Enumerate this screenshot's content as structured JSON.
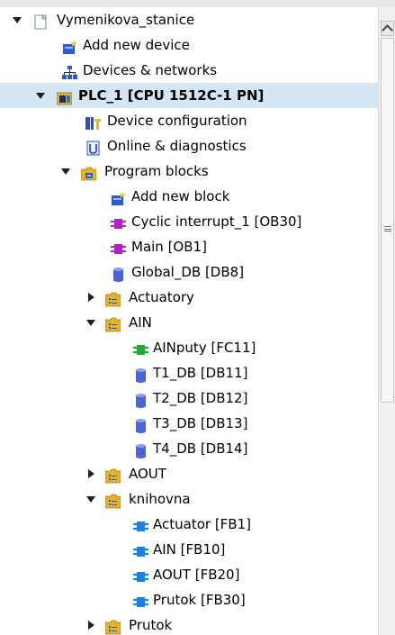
{
  "tree": {
    "items": [
      {
        "label": "Vymenikova_stanice",
        "icon": "project-icon",
        "expander": "down"
      },
      {
        "label": "Add new device",
        "icon": "add-device-icon"
      },
      {
        "label": "Devices & networks",
        "icon": "network-icon"
      },
      {
        "label": "PLC_1 [CPU 1512C-1 PN]",
        "icon": "plc-icon",
        "expander": "down",
        "bold": true,
        "selected": true
      },
      {
        "label": "Device configuration",
        "icon": "device-config-icon"
      },
      {
        "label": "Online & diagnostics",
        "icon": "diagnostics-icon"
      },
      {
        "label": "Program blocks",
        "icon": "folder-icon",
        "expander": "down"
      },
      {
        "label": "Add new block",
        "icon": "add-block-icon"
      },
      {
        "label": "Cyclic interrupt_1 [OB30]",
        "icon": "ob-block-icon"
      },
      {
        "label": "Main [OB1]",
        "icon": "ob-block-icon"
      },
      {
        "label": "Global_DB [DB8]",
        "icon": "db-icon"
      },
      {
        "label": "Actuatory",
        "icon": "group-folder-icon",
        "expander": "right"
      },
      {
        "label": "AIN",
        "icon": "group-folder-icon",
        "expander": "down"
      },
      {
        "label": "AINputy [FC11]",
        "icon": "fc-block-icon"
      },
      {
        "label": "T1_DB [DB11]",
        "icon": "db-icon"
      },
      {
        "label": "T2_DB [DB12]",
        "icon": "db-icon"
      },
      {
        "label": "T3_DB [DB13]",
        "icon": "db-icon"
      },
      {
        "label": "T4_DB [DB14]",
        "icon": "db-icon"
      },
      {
        "label": "AOUT",
        "icon": "group-folder-icon",
        "expander": "right"
      },
      {
        "label": "knihovna",
        "icon": "group-folder-icon",
        "expander": "down"
      },
      {
        "label": "Actuator [FB1]",
        "icon": "fb-block-icon"
      },
      {
        "label": "AIN [FB10]",
        "icon": "fb-block-icon"
      },
      {
        "label": "AOUT [FB20]",
        "icon": "fb-block-icon"
      },
      {
        "label": "Prutok [FB30]",
        "icon": "fb-block-icon"
      },
      {
        "label": "Prutok",
        "icon": "group-folder-icon",
        "expander": "right"
      }
    ]
  },
  "colors": {
    "selected_row": "#d5e6f3",
    "ob_block": "#b41ecc",
    "fc_block": "#22a83a",
    "fb_block": "#1d7fe0",
    "db": "#4a63d9",
    "folder": "#e6b422"
  }
}
